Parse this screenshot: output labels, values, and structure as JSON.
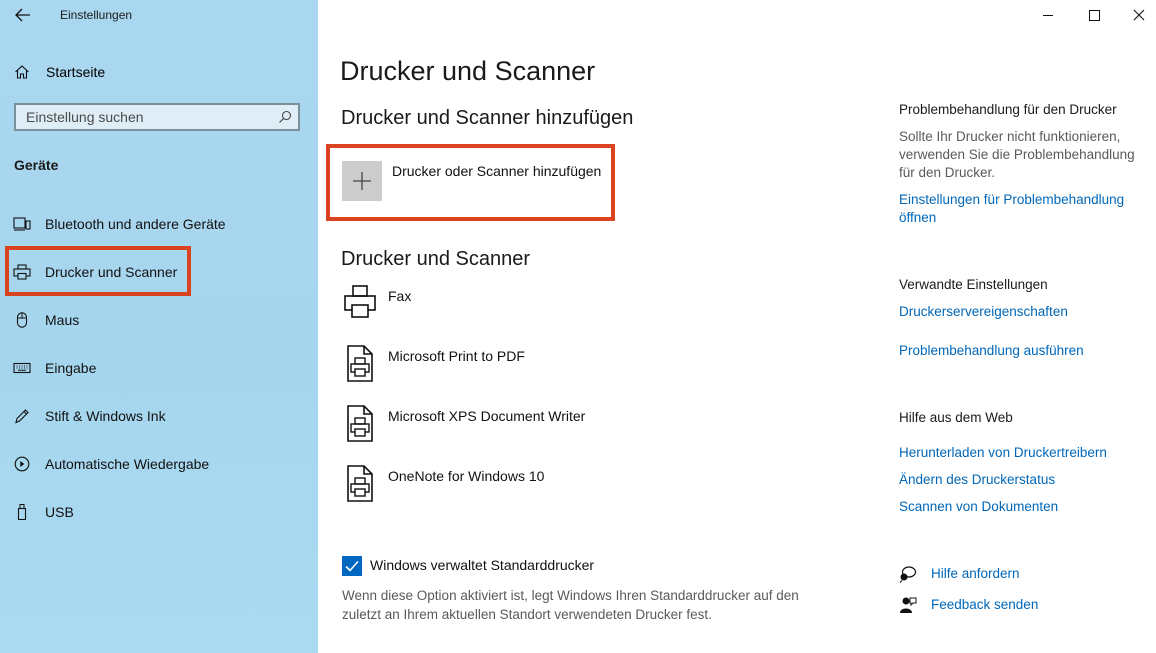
{
  "window": {
    "title": "Einstellungen"
  },
  "sidebar": {
    "home": "Startseite",
    "search_placeholder": "Einstellung suchen",
    "section": "Geräte",
    "items": [
      {
        "label": "Bluetooth und andere Geräte",
        "icon": "bluetooth-devices-icon"
      },
      {
        "label": "Drucker und Scanner",
        "icon": "printer-icon",
        "selected": true
      },
      {
        "label": "Maus",
        "icon": "mouse-icon"
      },
      {
        "label": "Eingabe",
        "icon": "keyboard-icon"
      },
      {
        "label": "Stift & Windows Ink",
        "icon": "pen-icon"
      },
      {
        "label": "Automatische Wiedergabe",
        "icon": "autoplay-icon"
      },
      {
        "label": "USB",
        "icon": "usb-icon"
      }
    ]
  },
  "main": {
    "title": "Drucker und Scanner",
    "add_section": {
      "heading": "Drucker und Scanner hinzufügen",
      "button_label": "Drucker oder Scanner hinzufügen"
    },
    "list_section": {
      "heading": "Drucker und Scanner",
      "devices": [
        {
          "name": "Fax",
          "icon": "fax-printer-icon"
        },
        {
          "name": "Microsoft Print to PDF",
          "icon": "document-printer-icon"
        },
        {
          "name": "Microsoft XPS Document Writer",
          "icon": "document-printer-icon"
        },
        {
          "name": "OneNote for Windows 10",
          "icon": "document-printer-icon"
        }
      ]
    },
    "default_printer": {
      "checkbox_label": "Windows verwaltet Standarddrucker",
      "checked": true,
      "description": "Wenn diese Option aktiviert ist, legt Windows Ihren Standarddrucker auf den zuletzt an Ihrem aktuellen Standort verwendeten Drucker fest."
    }
  },
  "right": {
    "troubleshoot": {
      "heading": "Problembehandlung für den Drucker",
      "text": "Sollte Ihr Drucker nicht funktionieren, verwenden Sie die Problembehandlung für den Drucker.",
      "link": "Einstellungen für Problembehandlung öffnen"
    },
    "related": {
      "heading": "Verwandte Einstellungen",
      "links": [
        "Druckerservereigenschaften",
        "Problembehandlung ausführen"
      ]
    },
    "web_help": {
      "heading": "Hilfe aus dem Web",
      "links": [
        "Herunterladen von Druckertreibern",
        "Ändern des Druckerstatus",
        "Scannen von Dokumenten"
      ]
    },
    "help_link": "Hilfe anfordern",
    "feedback_link": "Feedback senden"
  },
  "colors": {
    "accent": "#0067b8",
    "highlight": "#d9431f",
    "sidebar_bg": "#a9d7ef"
  }
}
